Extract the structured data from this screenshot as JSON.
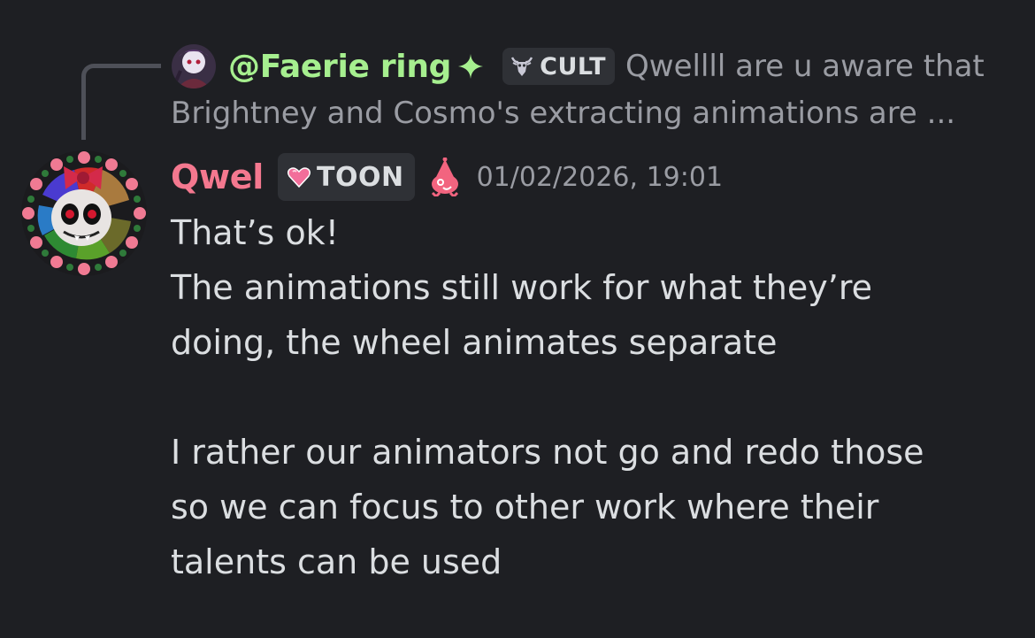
{
  "reply": {
    "author": "@Faerie ring",
    "tag": "CULT",
    "snippet_line1": "Qwellll are u aware that",
    "snippet_line2": "Brightney and Cosmo's extracting animations are ..."
  },
  "message": {
    "author": "Qwel",
    "tag": "TOON",
    "timestamp": "01/02/2026, 19:01",
    "lines": [
      "That’s ok!",
      "The animations still work for what they’re",
      "doing, the wheel animates separate",
      "",
      "I rather our animators not go and redo those",
      "so we can focus to other work where their",
      "talents can be used"
    ]
  },
  "colors": {
    "background": "#1e1f23",
    "reply_author": "#a6ef8f",
    "author": "#f4788f",
    "body_text": "#dbdee1",
    "muted_text": "#9a9ca3",
    "tag_bg": "#2f3136"
  },
  "icons": {
    "sparkle": "sparkle-icon",
    "cult_tag": "goat-skull-icon",
    "toon_tag": "pink-heart-icon",
    "role": "pink-clown-icon"
  }
}
